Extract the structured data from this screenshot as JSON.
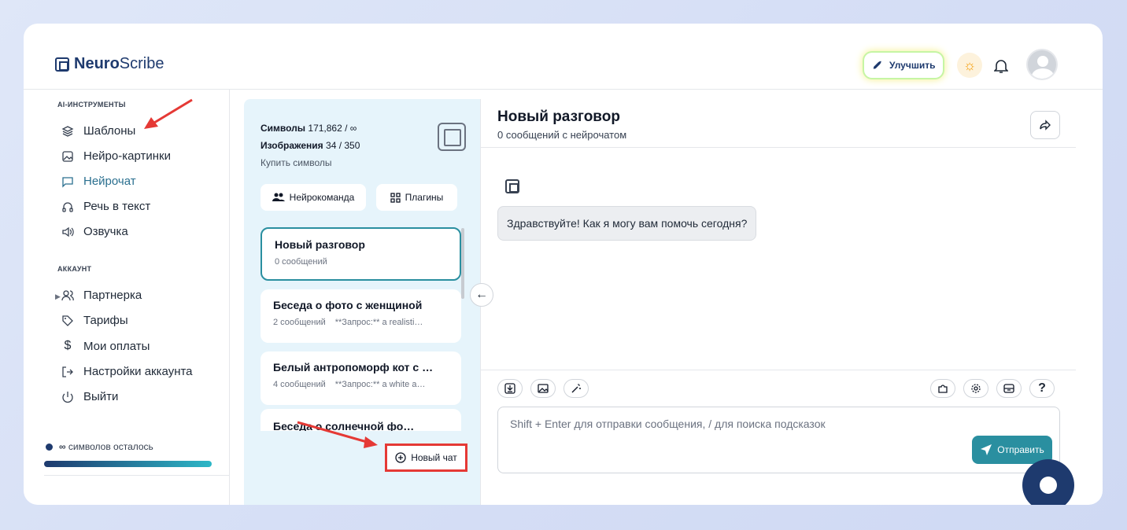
{
  "brand": {
    "name_bold": "Neuro",
    "name_rest": "Scribe"
  },
  "header": {
    "upgrade_label": "Улучшить"
  },
  "sidebar": {
    "ai_section": "AI-ИНСТРУМЕНТЫ",
    "ai_items": [
      "Шаблоны",
      "Нейро-картинки",
      "Нейрочат",
      "Речь в текст",
      "Озвучка"
    ],
    "account_section": "АККАУНТ",
    "account_items": [
      "Партнерка",
      "Тарифы",
      "Мои оплаты",
      "Настройки аккаунта",
      "Выйти"
    ],
    "remaining_symbol": "∞",
    "remaining_label": "символов осталось"
  },
  "chatlist": {
    "symbols_label": "Символы",
    "symbols_value": "171,862 / ∞",
    "images_label": "Изображения",
    "images_value": "34 / 350",
    "buy_label": "Купить символы",
    "team_label": "Нейрокоманда",
    "plugins_label": "Плагины",
    "conversations": [
      {
        "title": "Новый разговор",
        "meta": "0 сообщений",
        "preview": ""
      },
      {
        "title": "Беседа о фото с женщиной",
        "meta": "2 сообщений",
        "preview": "**Запрос:** a realisti…"
      },
      {
        "title": "Белый антропоморф кот с …",
        "meta": "4 сообщений",
        "preview": "**Запрос:** a white a…"
      }
    ],
    "partial_title": "Беседа о солнечной фо…",
    "new_chat_label": "Новый чат"
  },
  "chat": {
    "title": "Новый разговор",
    "subtitle": "0 сообщений с нейрочатом",
    "greeting": "Здравствуйте! Как я могу вам помочь сегодня?",
    "input_placeholder": "Shift + Enter для отправки сообщения, / для поиска подсказок",
    "send_label": "Отправить",
    "help_label": "?"
  }
}
